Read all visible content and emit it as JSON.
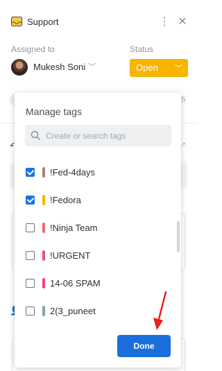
{
  "header": {
    "title": "Support"
  },
  "assignment": {
    "label": "Assigned to",
    "assignee": "Mukesh Soni"
  },
  "status": {
    "label": "Status",
    "value": "Open",
    "color": "#f7b500"
  },
  "background": {
    "side_number": "5"
  },
  "manage_tags": {
    "title": "Manage tags",
    "search_placeholder": "Create or search tags",
    "tags": [
      {
        "name": "!Fed-4days",
        "checked": true,
        "color": "#a98270"
      },
      {
        "name": "!Fedora",
        "checked": true,
        "color": "#f7b500"
      },
      {
        "name": "!Ninja Team",
        "checked": false,
        "color": "#ef6b73"
      },
      {
        "name": "!URGENT",
        "checked": false,
        "color": "#f04f6f"
      },
      {
        "name": "14-06 SPAM",
        "checked": false,
        "color": "#f0437a"
      },
      {
        "name": "2(3_puneet",
        "checked": false,
        "color": "#8aa0aa"
      }
    ],
    "done_label": "Done"
  },
  "colors": {
    "accent": "#1a6fdc",
    "arrow": "#e8201e"
  }
}
